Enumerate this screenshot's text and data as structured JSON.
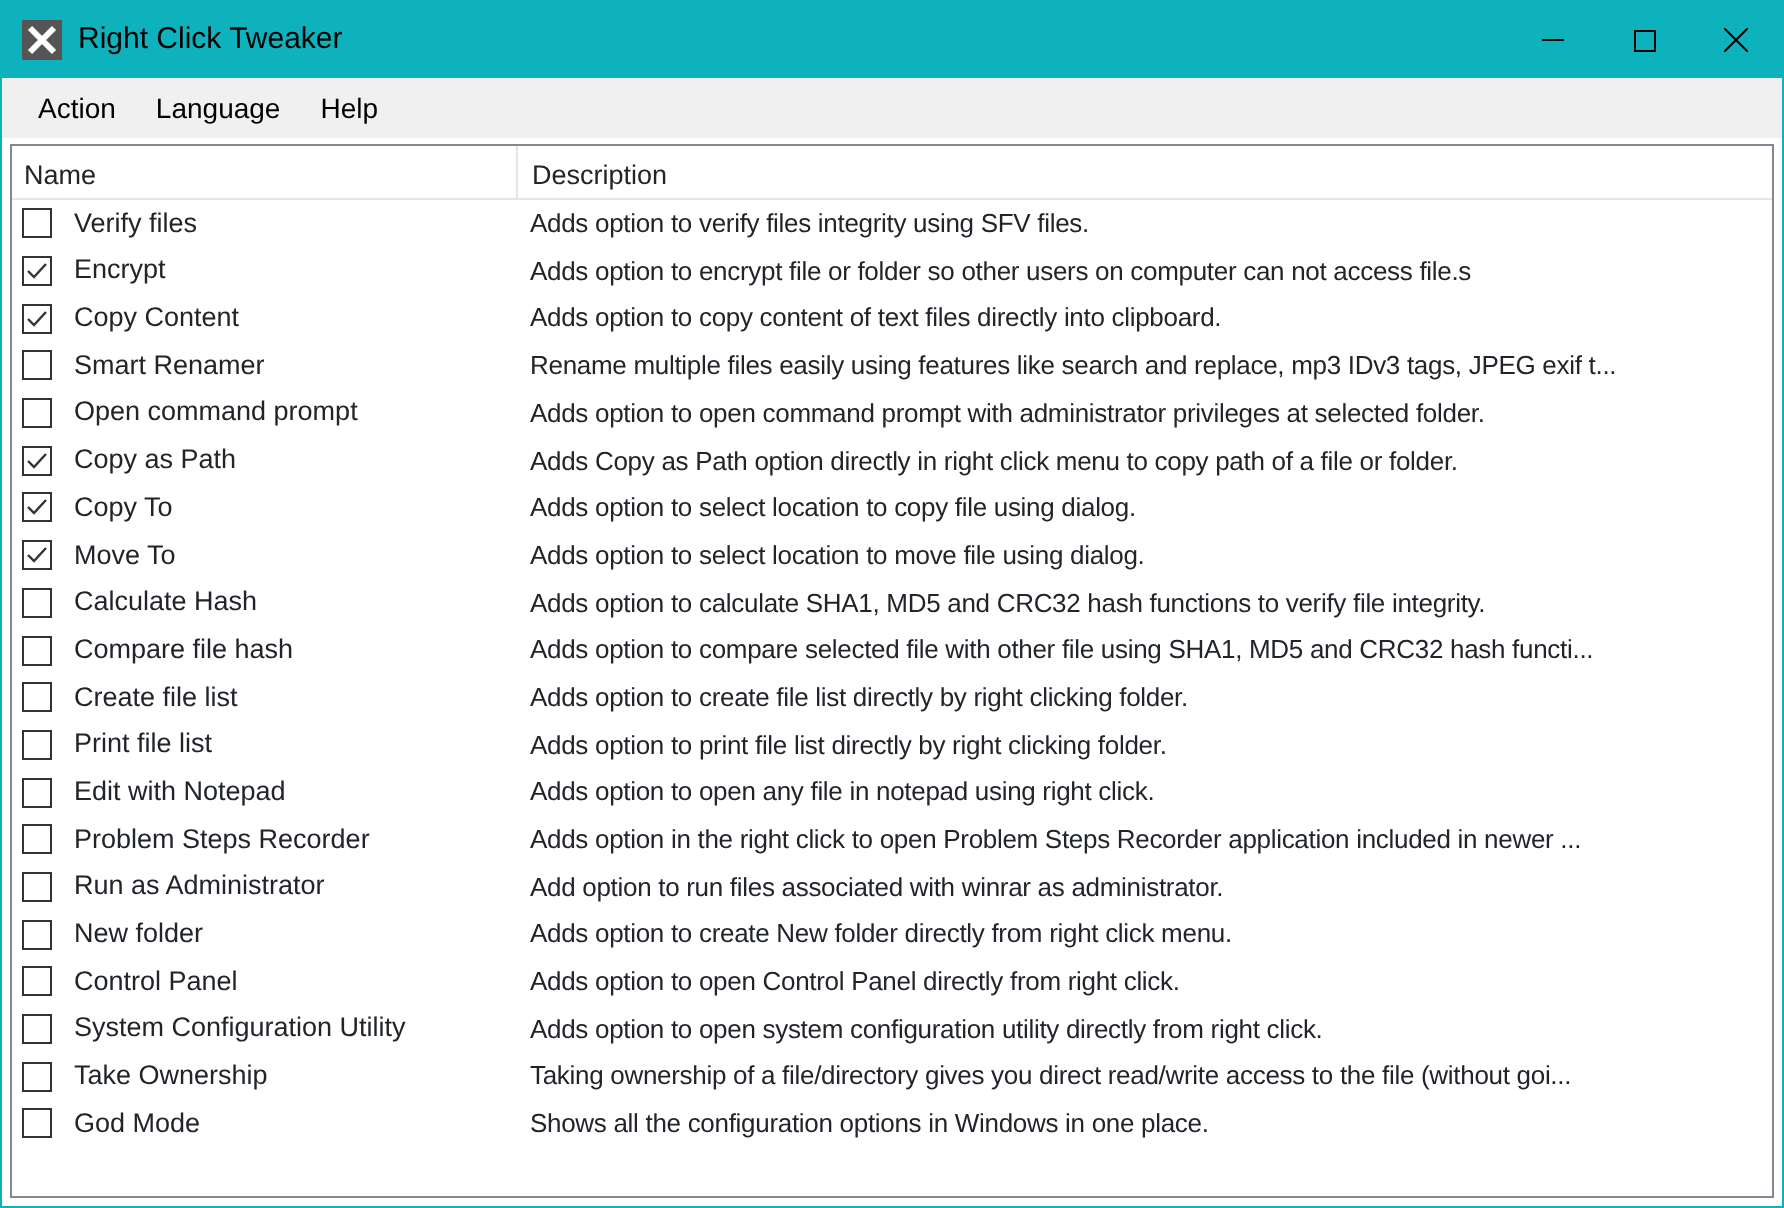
{
  "window": {
    "title": "Right Click Tweaker"
  },
  "menu": [
    "Action",
    "Language",
    "Help"
  ],
  "table": {
    "columns": [
      "Name",
      "Description"
    ],
    "rows": [
      {
        "name": "Verify files",
        "description": "Adds option to verify files integrity using SFV files.",
        "checked": false
      },
      {
        "name": "Encrypt",
        "description": "Adds option to encrypt file or folder so other users on computer can not access file.s",
        "checked": true
      },
      {
        "name": "Copy Content",
        "description": "Adds option to copy content of text files directly into clipboard.",
        "checked": true
      },
      {
        "name": "Smart Renamer",
        "description": "Rename multiple files easily using features like search and replace, mp3 IDv3 tags, JPEG exif t...",
        "checked": false
      },
      {
        "name": "Open command prompt",
        "description": "Adds option to open command prompt with administrator privileges at selected folder.",
        "checked": false
      },
      {
        "name": "Copy as Path",
        "description": "Adds Copy as Path option directly in right click menu to copy path of a file or folder.",
        "checked": true
      },
      {
        "name": "Copy To",
        "description": "Adds option to select location to copy file using dialog.",
        "checked": true
      },
      {
        "name": "Move To",
        "description": "Adds option to select location to move file using dialog.",
        "checked": true
      },
      {
        "name": "Calculate Hash",
        "description": "Adds option to calculate SHA1, MD5 and CRC32 hash functions to verify file integrity.",
        "checked": false
      },
      {
        "name": "Compare file hash",
        "description": "Adds option to compare selected file with other file using SHA1, MD5 and CRC32 hash functi...",
        "checked": false
      },
      {
        "name": "Create file list",
        "description": "Adds option to create file list directly by right clicking folder.",
        "checked": false
      },
      {
        "name": "Print file list",
        "description": "Adds option to print file list directly by right clicking folder.",
        "checked": false
      },
      {
        "name": "Edit with Notepad",
        "description": "Adds option to open any file in notepad using right click.",
        "checked": false
      },
      {
        "name": "Problem Steps Recorder",
        "description": "Adds option in the right click to open Problem Steps Recorder application included in newer ...",
        "checked": false
      },
      {
        "name": "Run as Administrator",
        "description": "Add option to run files associated with winrar as administrator.",
        "checked": false
      },
      {
        "name": "New folder",
        "description": "Adds option to create New folder directly from right click menu.",
        "checked": false
      },
      {
        "name": "Control Panel",
        "description": "Adds option to open Control Panel directly from right click.",
        "checked": false
      },
      {
        "name": "System Configuration Utility",
        "description": "Adds option to open system configuration utility directly from right click.",
        "checked": false
      },
      {
        "name": "Take Ownership",
        "description": "Taking ownership of a file/directory gives you direct read/write access to the file (without goi...",
        "checked": false
      },
      {
        "name": "God Mode",
        "description": "Shows all the configuration options in Windows in one place.",
        "checked": false
      }
    ]
  }
}
